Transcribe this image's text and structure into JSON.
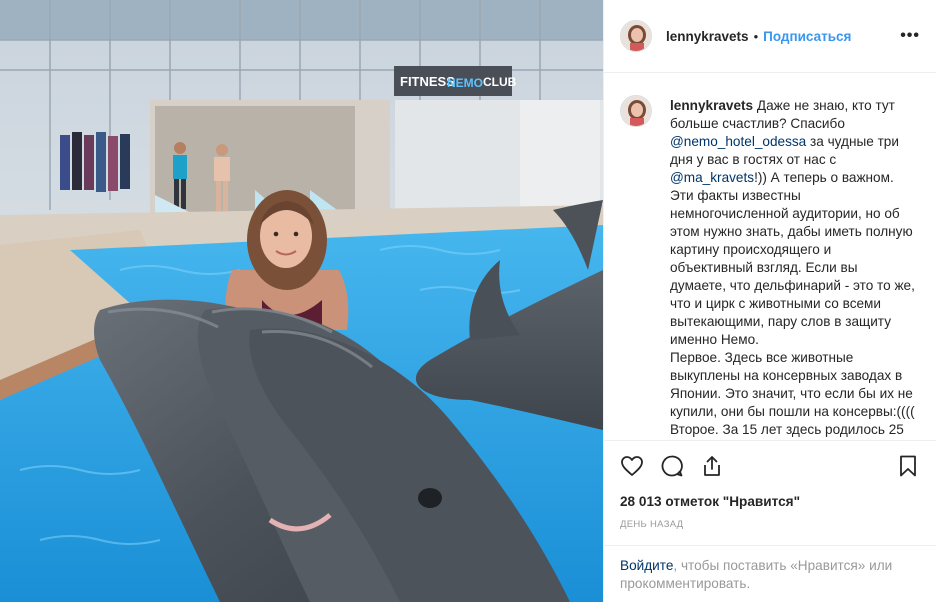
{
  "post": {
    "image_description_icon": "photo",
    "author": {
      "username": "lennykravets",
      "separator": "•",
      "follow_label": "Подписаться",
      "more_label": "•••"
    },
    "caption": {
      "username": "lennykravets",
      "part1": " Даже не знаю, кто тут больше счастлив? Спасибо ",
      "mention1": "@nemo_hotel_odessa",
      "part2": " за чудные три дня у вас в гостях от нас с ",
      "mention2": "@ma_kravets",
      "part3": "!)) А теперь о важном. Эти факты известны немногочисленной аудитории, но об этом нужно знать, дабы иметь полную картину происходящего и объективный взгляд. Если вы думаете, что дельфинарий - это то же, что и цирк с животными со всеми вытекающими, пару слов в защиту именно Немо.\nПервое. Здесь все животные выкуплены на консервных заводах в Японии. Это значит, что если бы их не купили, они бы пошли на консервы:((((\nВторое. За 15 лет здесь родилось 25"
    },
    "actions": {
      "like_icon": "heart-icon",
      "comment_icon": "comment-icon",
      "share_icon": "share-icon",
      "save_icon": "bookmark-icon"
    },
    "likes_label": "28 013 отметок \"Нравится\"",
    "time_ago": "ДЕНЬ НАЗАД",
    "login_prompt": {
      "link": "Войдите",
      "rest": ", чтобы поставить «Нравится» или прокомментировать."
    },
    "photo": {
      "sign_left": "FITNESS",
      "sign_brand": "NEMO",
      "sign_right": "CLUB"
    }
  },
  "colors": {
    "accent": "#3897f0",
    "mention": "#003569",
    "pool": "#1fa3e6",
    "dolphin": "#5a6068"
  }
}
